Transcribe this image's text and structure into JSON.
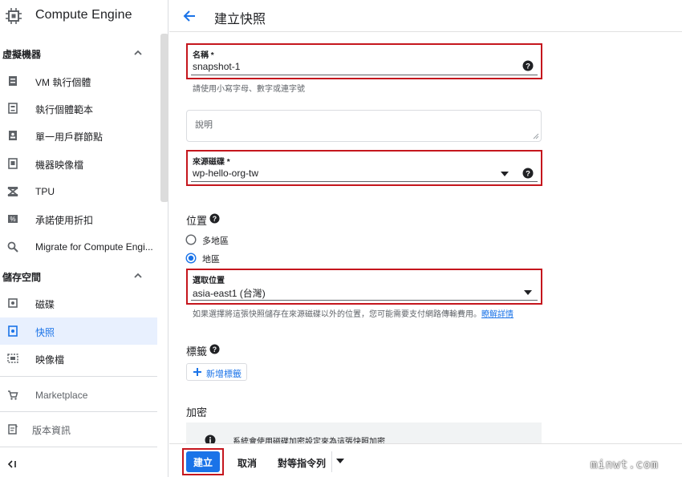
{
  "app": {
    "title": "Compute Engine"
  },
  "sidebar": {
    "sections": [
      {
        "label": "虛擬機器"
      },
      {
        "label": "儲存空間"
      }
    ],
    "items": [
      {
        "label": "VM 執行個體",
        "icon": "vm-instance-icon"
      },
      {
        "label": "執行個體範本",
        "icon": "instance-template-icon"
      },
      {
        "label": "單一用戶群節點",
        "icon": "sole-tenant-icon"
      },
      {
        "label": "機器映像檔",
        "icon": "machine-image-icon"
      },
      {
        "label": "TPU",
        "icon": "tpu-icon"
      },
      {
        "label": "承諾使用折扣",
        "icon": "discount-icon"
      },
      {
        "label": "Migrate for Compute Engi...",
        "icon": "search-icon"
      },
      {
        "label": "磁碟",
        "icon": "disk-icon"
      },
      {
        "label": "快照",
        "icon": "snapshot-icon",
        "active": true
      },
      {
        "label": "映像檔",
        "icon": "image-icon"
      },
      {
        "label": "Marketplace",
        "icon": "cart-icon"
      },
      {
        "label": "版本資訊",
        "icon": "release-notes-icon"
      }
    ]
  },
  "header": {
    "title": "建立快照"
  },
  "form": {
    "name": {
      "label": "名稱 *",
      "value": "snapshot-1",
      "helper": "請使用小寫字母、數字或連字號"
    },
    "description": {
      "placeholder": "說明"
    },
    "source_disk": {
      "label": "來源磁碟 *",
      "value": "wp-hello-org-tw"
    },
    "location": {
      "title": "位置",
      "options": [
        {
          "label": "多地區",
          "selected": false
        },
        {
          "label": "地區",
          "selected": true
        }
      ],
      "select_label": "選取位置",
      "select_value": "asia-east1 (台灣)",
      "helper": "如果選擇將這張快照儲存在來源磁碟以外的位置，您可能需要支付網路傳輸費用。",
      "helper_link": "瞭解詳情"
    },
    "labels": {
      "title": "標籤",
      "add_label": "新增標籤"
    },
    "encryption": {
      "title": "加密",
      "info": "系統會使用磁碟加密設定來為這張快照加密"
    }
  },
  "actions": {
    "create": "建立",
    "cancel": "取消",
    "equivalent": "對等指令列"
  },
  "watermark": "minwt.com",
  "colors": {
    "accent": "#1a73e8",
    "highlight": "#c5161d"
  }
}
